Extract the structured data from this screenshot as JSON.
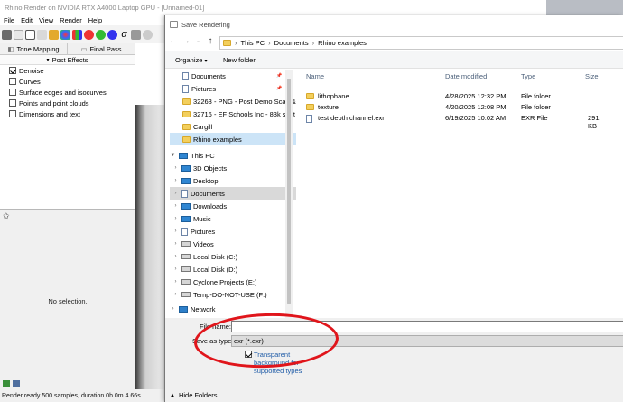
{
  "rhino": {
    "title": "Rhino Render on NVIDIA RTX A4000 Laptop GPU - [Unnamed-01]",
    "menu": [
      "File",
      "Edit",
      "View",
      "Render",
      "Help"
    ],
    "tabs": [
      "Tone Mapping",
      "Final Pass"
    ],
    "post_effects_label": "Post Effects",
    "post_effects": [
      {
        "label": "Denoise",
        "checked": true
      },
      {
        "label": "Curves",
        "checked": false
      },
      {
        "label": "Surface edges and isocurves",
        "checked": false
      },
      {
        "label": "Points and point clouds",
        "checked": false
      },
      {
        "label": "Dimensions and text",
        "checked": false
      }
    ],
    "no_selection": "No selection.",
    "status": "Render ready 500 samples, duration 0h 0m 4.66s"
  },
  "dialog": {
    "title": "Save Rendering",
    "breadcrumb": [
      "This PC",
      "Documents",
      "Rhino examples"
    ],
    "organize_label": "Organize",
    "new_folder_label": "New folder",
    "quick_access": [
      {
        "label": "Documents",
        "icon": "documents-icon",
        "pinned": true
      },
      {
        "label": "Pictures",
        "icon": "pictures-icon",
        "pinned": true
      },
      {
        "label": "32263 - PNG - Post Demo Scan &",
        "icon": "folder-icon",
        "pinned": false
      },
      {
        "label": "32716 - EF Schools Inc  - 83k sq ft",
        "icon": "folder-icon",
        "pinned": false
      },
      {
        "label": "Cargill",
        "icon": "folder-icon",
        "pinned": false
      },
      {
        "label": "Rhino examples",
        "icon": "folder-icon",
        "pinned": false
      }
    ],
    "this_pc_label": "This PC",
    "this_pc_items": [
      {
        "label": "3D Objects",
        "icon": "3d-objects-icon"
      },
      {
        "label": "Desktop",
        "icon": "desktop-icon"
      },
      {
        "label": "Documents",
        "icon": "documents-icon",
        "selected": true
      },
      {
        "label": "Downloads",
        "icon": "downloads-icon"
      },
      {
        "label": "Music",
        "icon": "music-icon"
      },
      {
        "label": "Pictures",
        "icon": "pictures-icon"
      },
      {
        "label": "Videos",
        "icon": "videos-icon"
      },
      {
        "label": "Local Disk (C:)",
        "icon": "drive-icon"
      },
      {
        "label": "Local Disk (D:)",
        "icon": "drive-icon"
      },
      {
        "label": "Cyclone Projects (E:)",
        "icon": "network-drive-icon"
      },
      {
        "label": "Temp-DO-NOT-USE (F:)",
        "icon": "network-drive-icon"
      }
    ],
    "network_label": "Network",
    "columns": [
      "Name",
      "Date modified",
      "Type",
      "Size"
    ],
    "files": [
      {
        "name": "lithophane",
        "date": "4/28/2025 12:32 PM",
        "type": "File folder",
        "size": "",
        "icon": "folder-icon"
      },
      {
        "name": "texture",
        "date": "4/20/2025 12:08 PM",
        "type": "File folder",
        "size": "",
        "icon": "folder-icon"
      },
      {
        "name": "test depth channel.exr",
        "date": "6/19/2025 10:02 AM",
        "type": "EXR File",
        "size": "291 KB",
        "icon": "exr-file-icon"
      }
    ],
    "file_name_label": "File name:",
    "file_name_value": "",
    "save_type_label": "Save as type:",
    "save_type_value": "exr (*.exr)",
    "transparent_label": "Transparent background for supported types",
    "transparent_checked": true,
    "hide_folders_label": "Hide Folders",
    "annotation_color": "#e0151b"
  }
}
